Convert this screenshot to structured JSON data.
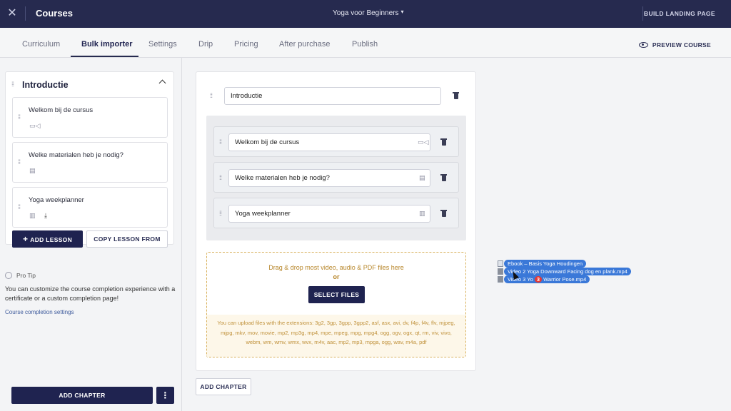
{
  "topbar": {
    "close_icon": "close-icon",
    "title": "Courses",
    "course_name": "Yoga voor Beginners",
    "course_caret": "▾",
    "build_landing_page": "BUILD LANDING PAGE"
  },
  "tabs": [
    {
      "label": "Curriculum",
      "active": false
    },
    {
      "label": "Bulk importer",
      "active": true
    },
    {
      "label": "Settings",
      "active": false
    },
    {
      "label": "Drip",
      "active": false
    },
    {
      "label": "Pricing",
      "active": false
    },
    {
      "label": "After purchase",
      "active": false
    },
    {
      "label": "Publish",
      "active": false
    }
  ],
  "preview_course": "PREVIEW COURSE",
  "sidebar": {
    "chapter_title": "Introductie",
    "lessons": [
      {
        "name": "Welkom bij de cursus",
        "icon": "video-icon"
      },
      {
        "name": "Welke materialen heb je nodig?",
        "icon": "document-icon"
      },
      {
        "name": "Yoga weekplanner",
        "icon": "file-icon",
        "extra_icon": "download-icon"
      }
    ],
    "add_lesson": "ADD LESSON",
    "copy_lesson_from": "COPY LESSON FROM",
    "pro_tip_label": "Pro Tip",
    "pro_tip_text": "You can customize the course completion experience with a certificate or a custom completion page!",
    "pro_tip_link": "Course completion settings",
    "add_chapter": "ADD CHAPTER",
    "more": "⋮"
  },
  "editor": {
    "chapter_name": "Introductie",
    "lessons": [
      {
        "name": "Welkom bij de cursus",
        "icon": "video-icon"
      },
      {
        "name": "Welke materialen heb je nodig?",
        "icon": "document-icon"
      },
      {
        "name": "Yoga weekplanner",
        "icon": "file-icon"
      }
    ],
    "dropzone": {
      "instruction": "Drag & drop most video, audio & PDF files here",
      "or": "or",
      "select_files": "SELECT FILES",
      "extensions": "You can upload files with the extensions: 3g2, 3gp, 3gpp, 3gpp2, asf, asx, avi, dv, f4p, f4v, flv, mjpeg, mjpg, mkv, mov, movie, mp2, mp3g, mp4, mpe, mpeg, mpg, mpg4, ogg, ogv, ogx, qt, rm, viv, vivo, webm, wm, wmv, wmx, wvx, m4v, aac, mp2, mp3, mpga, ogg, wav, m4a, pdf"
    },
    "add_chapter": "ADD CHAPTER"
  },
  "drag_ghost": {
    "files": [
      "Ebook – Basis Yoga Houdingen",
      "Video 2 Yoga Downward Facing dog en plank.mp4",
      "Video 3 Yo",
      "Warrior Pose.mp4"
    ],
    "count_badge": "3"
  }
}
